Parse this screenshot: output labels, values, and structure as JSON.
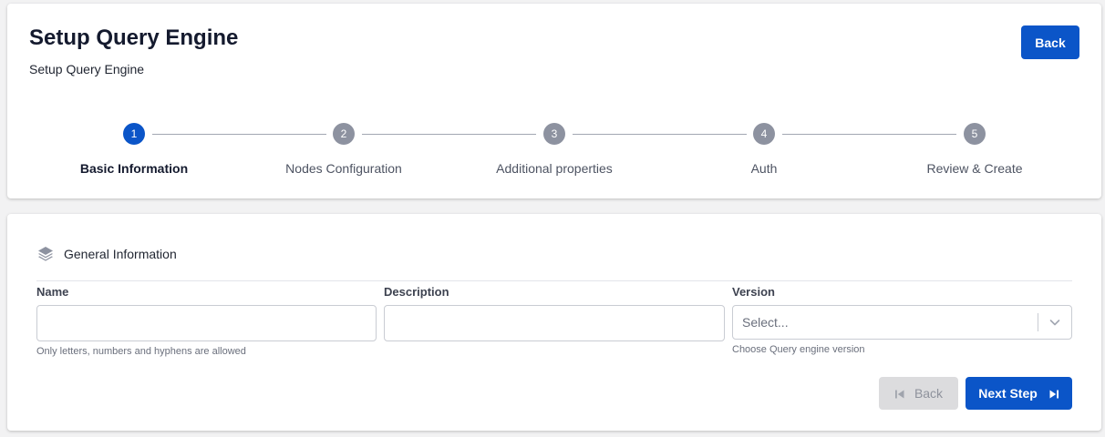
{
  "header": {
    "title": "Setup Query Engine",
    "subtitle": "Setup Query Engine",
    "back_label": "Back"
  },
  "stepper": {
    "active_step": 1,
    "steps": [
      {
        "number": "1",
        "label": "Basic Information"
      },
      {
        "number": "2",
        "label": "Nodes Configuration"
      },
      {
        "number": "3",
        "label": "Additional properties"
      },
      {
        "number": "4",
        "label": "Auth"
      },
      {
        "number": "5",
        "label": "Review & Create"
      }
    ]
  },
  "form": {
    "section_title": "General Information",
    "section_icon": "layers-icon",
    "name": {
      "label": "Name",
      "value": "",
      "hint": "Only letters, numbers and hyphens are allowed"
    },
    "description": {
      "label": "Description",
      "value": ""
    },
    "version": {
      "label": "Version",
      "placeholder": "Select...",
      "hint": "Choose Query engine version"
    },
    "back_label": "Back",
    "next_label": "Next Step"
  },
  "colors": {
    "primary": "#0b55c8",
    "step_inactive": "#8d92a0",
    "disabled_bg": "#dcdcde"
  }
}
